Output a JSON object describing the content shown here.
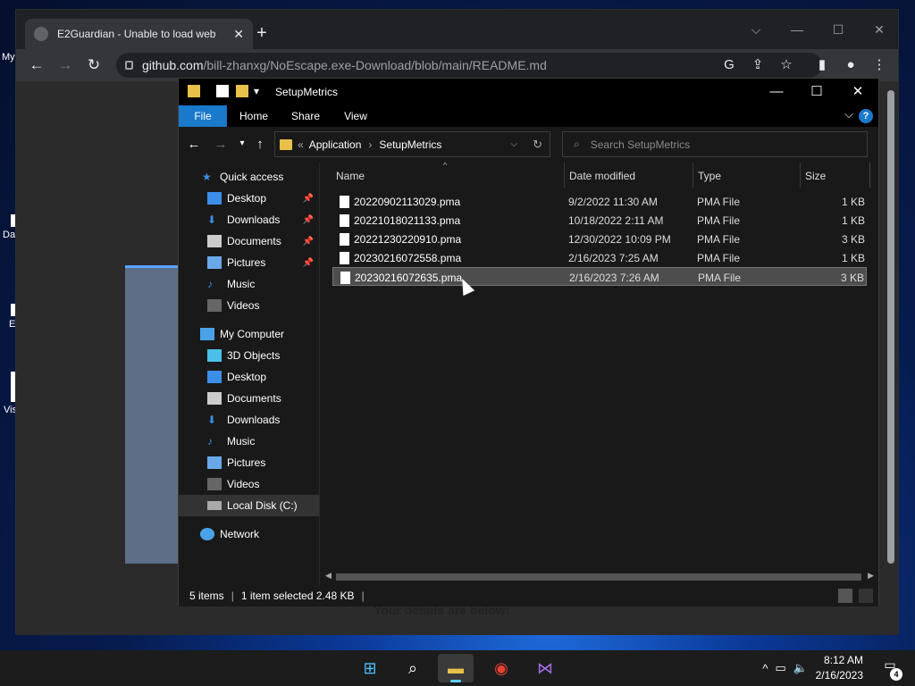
{
  "desktop": {
    "icon_labels": [
      "My",
      "Da",
      "E",
      "Vis"
    ]
  },
  "chrome": {
    "tab_title": "E2Guardian - Unable to load web",
    "new_tab_symbol": "+",
    "url_host": "github.com",
    "url_path": "/bill-zhanxg/NoEscape.exe-Download/blob/main/README.md",
    "page_text": "Your details are below:"
  },
  "explorer": {
    "title": "SetupMetrics",
    "ribbon_tabs": [
      "File",
      "Home",
      "Share",
      "View"
    ],
    "help_label": "?",
    "address": {
      "chevron": "«",
      "crumbs": [
        "Application",
        "SetupMetrics"
      ]
    },
    "search_placeholder": "Search SetupMetrics",
    "nav": {
      "quick_access": "Quick access",
      "quick_items": [
        "Desktop",
        "Downloads",
        "Documents",
        "Pictures",
        "Music",
        "Videos"
      ],
      "my_computer": "My Computer",
      "computer_items": [
        "3D Objects",
        "Desktop",
        "Documents",
        "Downloads",
        "Music",
        "Pictures",
        "Videos",
        "Local Disk (C:)"
      ],
      "network": "Network"
    },
    "columns": [
      "Name",
      "Date modified",
      "Type",
      "Size"
    ],
    "files": [
      {
        "name": "20220902113029.pma",
        "date": "9/2/2022 11:30 AM",
        "type": "PMA File",
        "size": "1 KB"
      },
      {
        "name": "20221018021133.pma",
        "date": "10/18/2022 2:11 AM",
        "type": "PMA File",
        "size": "1 KB"
      },
      {
        "name": "20221230220910.pma",
        "date": "12/30/2022 10:09 PM",
        "type": "PMA File",
        "size": "3 KB"
      },
      {
        "name": "20230216072558.pma",
        "date": "2/16/2023 7:25 AM",
        "type": "PMA File",
        "size": "1 KB"
      },
      {
        "name": "20230216072635.pma",
        "date": "2/16/2023 7:26 AM",
        "type": "PMA File",
        "size": "3 KB"
      }
    ],
    "selected_file": "20230216072635.pma",
    "status": {
      "items": "5 items",
      "selection": "1 item selected  2.48 KB"
    }
  },
  "taskbar": {
    "time": "8:12 AM",
    "date": "2/16/2023",
    "notification_count": "4",
    "apps": [
      "start-icon",
      "search-icon",
      "file-explorer-icon",
      "chrome-icon",
      "visual-studio-icon"
    ]
  },
  "colors": {
    "accent": "#1979ca",
    "folder": "#e8c14a",
    "selection": "#4d4d4d"
  }
}
